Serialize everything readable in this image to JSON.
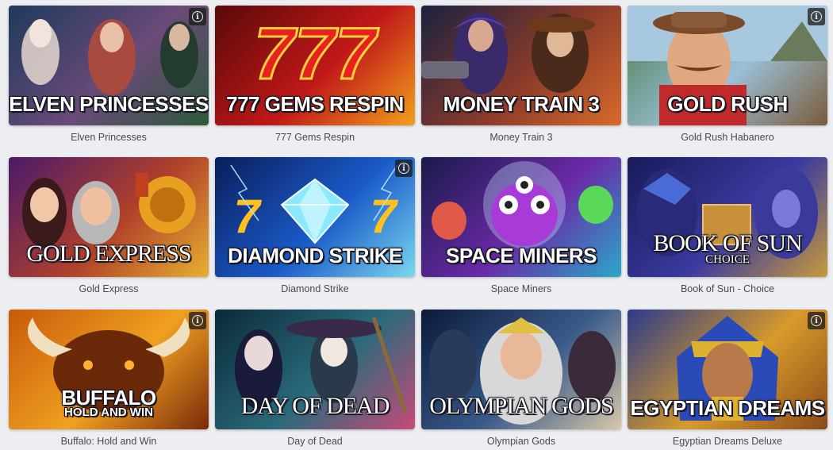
{
  "games": [
    {
      "id": "elven-princesses",
      "title": "Elven Princesses",
      "logo": "ELVEN PRINCESSES",
      "logo_sub": "",
      "style": "sans",
      "has_info": true,
      "colors": [
        "#1e3a5c",
        "#6a4a78",
        "#2b5a3a"
      ],
      "art": "elves"
    },
    {
      "id": "777-gems-respin",
      "title": "777 Gems Respin",
      "logo": "777 GEMS RESPIN",
      "logo_sub": "",
      "style": "sans",
      "has_info": false,
      "colors": [
        "#5a0a0a",
        "#c01818",
        "#f2a01c"
      ],
      "art": "sevens"
    },
    {
      "id": "money-train-3",
      "title": "Money Train 3",
      "logo": "MONEY TRAIN 3",
      "logo_sub": "",
      "style": "sans",
      "has_info": false,
      "colors": [
        "#1a2240",
        "#8a3a2a",
        "#d86a2a"
      ],
      "art": "train"
    },
    {
      "id": "gold-rush",
      "title": "Gold Rush Habanero",
      "logo": "GOLD RUSH",
      "logo_sub": "",
      "style": "sans",
      "has_info": true,
      "colors": [
        "#4a7a4a",
        "#9ac0d8",
        "#7a5a3a"
      ],
      "art": "miner"
    },
    {
      "id": "gold-express",
      "title": "Gold Express",
      "logo": "GOLD EXPRESS",
      "logo_sub": "",
      "style": "serif",
      "has_info": false,
      "colors": [
        "#4a1a6a",
        "#b0402a",
        "#e8b030"
      ],
      "art": "express"
    },
    {
      "id": "diamond-strike",
      "title": "Diamond Strike",
      "logo": "DIAMOND STRIKE",
      "logo_sub": "",
      "style": "sans",
      "has_info": true,
      "colors": [
        "#0a1e5a",
        "#1a5ac8",
        "#7ad8f0"
      ],
      "art": "diamond"
    },
    {
      "id": "space-miners",
      "title": "Space Miners",
      "logo": "SPACE MINERS",
      "logo_sub": "",
      "style": "sans",
      "has_info": false,
      "colors": [
        "#1a1a4a",
        "#6a2aa8",
        "#2aa8c8"
      ],
      "art": "aliens"
    },
    {
      "id": "book-of-sun",
      "title": "Book of Sun - Choice",
      "logo": "BOOK OF SUN",
      "logo_sub": "CHOICE",
      "style": "serif",
      "has_info": false,
      "colors": [
        "#1a1a5a",
        "#3a3aa0",
        "#c89a3a"
      ],
      "art": "egypt-blue"
    },
    {
      "id": "buffalo",
      "title": "Buffalo: Hold and Win",
      "logo": "BUFFALO",
      "logo_sub": "HOLD AND WIN",
      "style": "sans",
      "has_info": true,
      "colors": [
        "#c85a0a",
        "#f0a020",
        "#7a2a0a"
      ],
      "art": "buffalo"
    },
    {
      "id": "day-of-dead",
      "title": "Day of Dead",
      "logo": "DAY OF DEAD",
      "logo_sub": "",
      "style": "serif",
      "has_info": false,
      "colors": [
        "#0a2a3a",
        "#2a6a7a",
        "#c84a7a"
      ],
      "art": "skull"
    },
    {
      "id": "olympian-gods",
      "title": "Olympian Gods",
      "logo": "OLYMPIAN GODS",
      "logo_sub": "",
      "style": "serif",
      "has_info": false,
      "colors": [
        "#0a1a3a",
        "#3a5a8a",
        "#d8c8a8"
      ],
      "art": "zeus"
    },
    {
      "id": "egyptian-dreams",
      "title": "Egyptian Dreams Deluxe",
      "logo": "EGYPTIAN DREAMS",
      "logo_sub": "",
      "style": "sans",
      "has_info": true,
      "colors": [
        "#2a3a8a",
        "#d89a2a",
        "#8a4a1a"
      ],
      "art": "pharaoh"
    }
  ],
  "info_icon": "info-icon",
  "info_glyph": "i"
}
